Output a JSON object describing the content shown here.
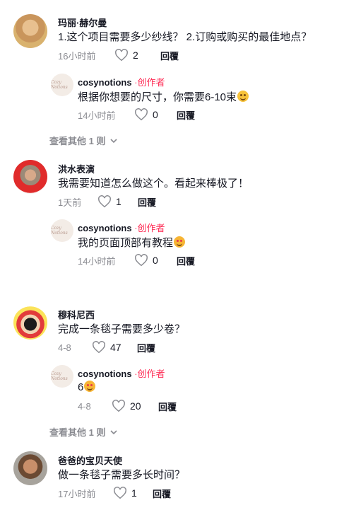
{
  "comments": [
    {
      "username": "玛丽·赫尔曼",
      "text": "1.这个项目需要多少纱线？ 2.订购或购买的最佳地点？",
      "time": "16小时前",
      "likes": "2",
      "reply_label": "回覆",
      "reply": {
        "username": "cosynotions",
        "creator_tag": "·创作者",
        "text": "根据你想要的尺寸，你需要6-10束",
        "emoji": "hugging-face",
        "time": "14小时前",
        "likes": "0",
        "reply_label": "回覆"
      },
      "more_label": "查看其他 1 则"
    },
    {
      "username": "洪水表演",
      "text": "我需要知道怎么做这个。看起来棒极了！",
      "time": "1天前",
      "likes": "1",
      "reply_label": "回覆",
      "reply": {
        "username": "cosynotions",
        "creator_tag": "·创作者",
        "text": "我的页面顶部有教程",
        "emoji": "smiling-face-with-hearts",
        "time": "14小时前",
        "likes": "0",
        "reply_label": "回覆"
      }
    },
    {
      "username": "穆科尼西",
      "text": "完成一条毯子需要多少卷？",
      "time": "4-8",
      "likes": "47",
      "reply_label": "回覆",
      "reply": {
        "username": "cosynotions",
        "creator_tag": "·创作者",
        "text": "6",
        "emoji": "smiling-face-with-hearts",
        "time": "4-8",
        "likes": "20",
        "reply_label": "回覆"
      },
      "more_label": "查看其他 1 则"
    },
    {
      "username": "爸爸的宝贝天使",
      "text": "做一条毯子需要多长时间？",
      "time": "17小时前",
      "likes": "1",
      "reply_label": "回覆"
    }
  ],
  "reply_avatar_text": "Cozy Notions",
  "colors": {
    "creator": "#fe2c55",
    "meta": "#8a8b91",
    "text": "#161823"
  }
}
